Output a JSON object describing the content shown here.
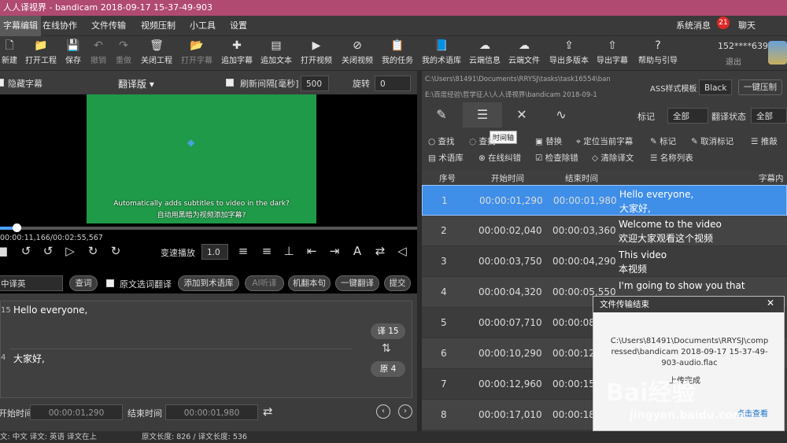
{
  "title": "人人译视界 - bandicam 2018-09-17 15-37-49-903",
  "menu": [
    "字幕编辑",
    "在线协作",
    "文件传输",
    "视频压制",
    "小工具",
    "设置"
  ],
  "header_right": {
    "system_msg": "系统消息",
    "msg_count": "21",
    "chat": "聊天",
    "user": "152****6399",
    "logout": "退出"
  },
  "toolbar": [
    "新建",
    "打开工程",
    "保存",
    "撤销",
    "重做",
    "关闭工程",
    "打开字幕",
    "追加字幕",
    "追加文本",
    "打开视频",
    "关闭视频",
    "我的任务",
    "我的术语库",
    "云端信息",
    "云端文件",
    "导出多版本",
    "导出字幕",
    "帮助与引导"
  ],
  "left": {
    "hide_sub": "隐藏字幕",
    "version": "翻译版 ▾",
    "refresh_label": "刷新间隔[毫秒]",
    "refresh_val": "500",
    "rotate_label": "旋转",
    "rotate_val": "0",
    "sub_en": "Automatically adds subtitles to video in the dark?",
    "sub_cn": "自动用黑暗为视频添加字幕?",
    "time": "00:00:11,166/00:02:55,567",
    "speed_label": "变速播放",
    "speed_val": "1.0",
    "lang": "中译英",
    "query": "查词",
    "orig_sel": "原文选词翻译",
    "add_term": "添加到术语库",
    "ai": "AI听译",
    "mt": "机翻本句",
    "one_key": "一键翻译",
    "submit": "提交",
    "line1_num": "15",
    "line1": "Hello everyone,",
    "line2_num": "4",
    "line2": "大家好,",
    "trans_badge": "译 15",
    "orig_badge": "原 4",
    "start_label": "开始时间",
    "start": "00:00:01,290",
    "end_label": "结束时间",
    "end": "00:00:01,980"
  },
  "right": {
    "path1": "C:\\Users\\81491\\Documents\\RRYSJ\\tasks\\task16554\\ban",
    "path2": "E:\\百度经验\\哲学征人\\人人译视界\\bandicam 2018-09-1",
    "ass": "ASS样式模板",
    "ass_val": "Black",
    "one_key_burn": "一键压制",
    "mark": "标记",
    "mark_val": "全部",
    "trans_status": "翻译状态",
    "trans_val": "全部",
    "tooltip": "时间轴",
    "tools1": [
      "查找",
      "查找",
      "替换",
      "定位当前字幕",
      "标记",
      "取消标记",
      "推敲"
    ],
    "tools2": [
      "术语库",
      "在线纠错",
      "检查除错",
      "清除译文",
      "名称列表"
    ],
    "cols": [
      "序号",
      "开始时间",
      "结束时间",
      "字幕内"
    ],
    "rows": [
      {
        "n": "1",
        "s": "00:00:01,290",
        "e": "00:00:01,980",
        "en": "Hello everyone,",
        "cn": "大家好,"
      },
      {
        "n": "2",
        "s": "00:00:02,040",
        "e": "00:00:03,360",
        "en": "Welcome to the video",
        "cn": "欢迎大家观看这个视频"
      },
      {
        "n": "3",
        "s": "00:00:03,750",
        "e": "00:00:04,290",
        "en": "This video",
        "cn": "本视频"
      },
      {
        "n": "4",
        "s": "00:00:04,320",
        "e": "00:00:05,550",
        "en": "I'm going to show you that",
        "cn": ""
      },
      {
        "n": "5",
        "s": "00:00:07,710",
        "e": "00:00:08,",
        "en": "",
        "cn": ""
      },
      {
        "n": "6",
        "s": "00:00:10,290",
        "e": "00:00:12",
        "en": "",
        "cn": ""
      },
      {
        "n": "7",
        "s": "00:00:12,960",
        "e": "00:00:15",
        "en": "",
        "cn": ""
      },
      {
        "n": "8",
        "s": "00:00:17,010",
        "e": "00:00:18",
        "en": "",
        "cn": ""
      }
    ]
  },
  "popup": {
    "title": "文件传输结束",
    "body": "C:\\Users\\81491\\Documents\\RRYSJ\\compressed\\bandicam 2018-09-17 15-37-49-903-audio.flac",
    "status": "上传完成",
    "link": "点击查看"
  },
  "status": {
    "lang": "文: 中文 译文: 英语  译文在上",
    "len": "原文长度: 826 / 译文长度: 536"
  },
  "watermark": {
    "logo": "Bai经验",
    "url": "jingyan.baidu.com"
  }
}
